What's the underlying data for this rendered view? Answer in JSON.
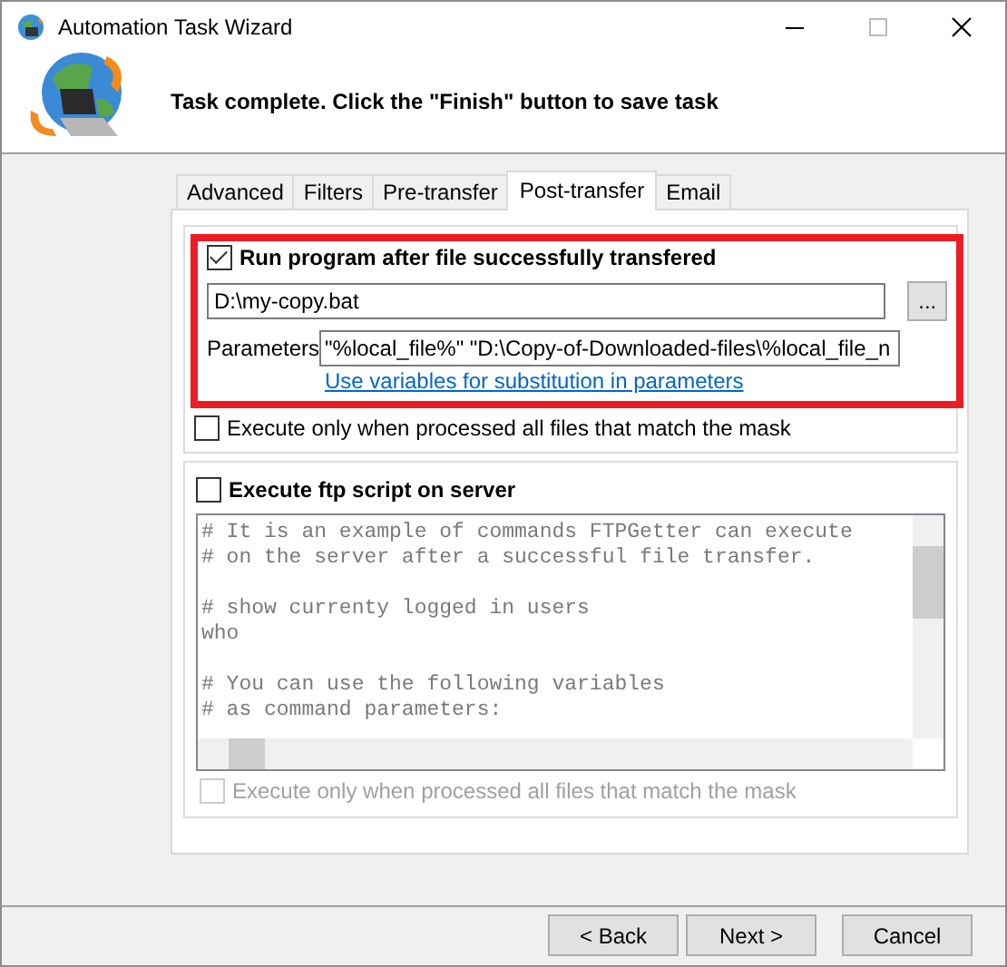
{
  "window": {
    "title": "Automation Task Wizard"
  },
  "header": {
    "message": "Task complete. Click the \"Finish\" button to save task"
  },
  "tabs": [
    {
      "label": "Advanced",
      "selected": false
    },
    {
      "label": "Filters",
      "selected": false
    },
    {
      "label": "Pre-transfer",
      "selected": false
    },
    {
      "label": "Post-transfer",
      "selected": true
    },
    {
      "label": "Email",
      "selected": false
    }
  ],
  "run_program": {
    "label": "Run program after file successfully transfered",
    "checked": true,
    "program_path": "D:\\my-copy.bat",
    "browse_label": "...",
    "parameters_label": "Parameters",
    "parameters": "\"%local_file%\" \"D:\\Copy-of-Downloaded-files\\%local_file_n",
    "variables_link": "Use variables for substitution in parameters",
    "only_when_all": {
      "label": "Execute only when processed all files that match the mask",
      "checked": false,
      "disabled": false
    }
  },
  "ftp_script": {
    "label": "Execute ftp script on server",
    "checked": false,
    "script_blocks": [
      [
        "# It is an example of commands FTPGetter can execute",
        "# on the server after a successful file transfer."
      ],
      [
        "# show currenty logged in users",
        "who"
      ],
      [
        "# You can use the following variables",
        "# as command parameters:"
      ]
    ],
    "only_when_all": {
      "label": "Execute only when processed all files that match the mask",
      "checked": false,
      "disabled": true
    }
  },
  "buttons": [
    {
      "label": "< Back",
      "disabled": false
    },
    {
      "label": "Next >",
      "disabled": false
    },
    {
      "label": "Cancel",
      "disabled": false
    }
  ]
}
